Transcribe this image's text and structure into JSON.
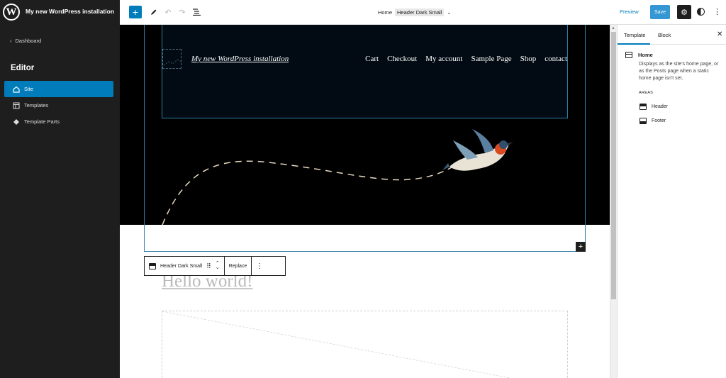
{
  "sidebar": {
    "site_title": "My new WordPress installation",
    "dashboard_label": "Dashboard",
    "heading": "Editor",
    "items": [
      {
        "label": "Site",
        "active": true
      },
      {
        "label": "Templates",
        "active": false
      },
      {
        "label": "Template Parts",
        "active": false
      }
    ]
  },
  "topbar": {
    "doc_title_prefix": "Home",
    "doc_title_badge": "Header Dark Small",
    "preview_label": "Preview",
    "save_label": "Save"
  },
  "canvas": {
    "header_site_title": "My new WordPress installation",
    "nav_items": [
      "Cart",
      "Checkout",
      "My account",
      "Sample Page",
      "Shop",
      "contact"
    ],
    "post_title": "Hello world!"
  },
  "block_toolbar": {
    "block_name": "Header Dark Small",
    "replace_label": "Replace"
  },
  "panel": {
    "tabs": [
      "Template",
      "Block"
    ],
    "template_name": "Home",
    "template_description": "Displays as the site's home page, or as the Posts page when a static home page isn't set.",
    "areas_heading": "AREAS",
    "areas": [
      "Header",
      "Footer"
    ]
  },
  "colors": {
    "accent": "#007cba",
    "sidebar_bg": "#1e1e1e",
    "header_bg": "#000000"
  }
}
